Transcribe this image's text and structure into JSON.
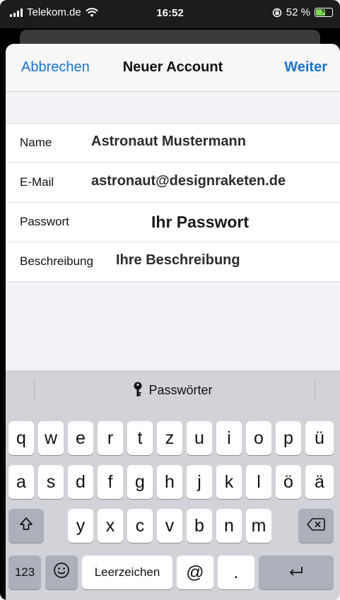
{
  "status_bar": {
    "carrier": "Telekom.de",
    "time": "16:52",
    "battery": "52 %"
  },
  "nav": {
    "cancel": "Abbrechen",
    "title": "Neuer Account",
    "next": "Weiter"
  },
  "form": {
    "rows": [
      {
        "label": "Name",
        "value": "Astronaut Mustermann"
      },
      {
        "label": "E-Mail",
        "value": "astronaut@designraketen.de"
      },
      {
        "label": "Passwort",
        "value": "Ihr Passwort"
      },
      {
        "label": "Beschreibung",
        "value": "Ihre Beschreibung"
      }
    ]
  },
  "keyboard": {
    "suggestion": "Passwörter",
    "row1": [
      "q",
      "w",
      "e",
      "r",
      "t",
      "z",
      "u",
      "i",
      "o",
      "p",
      "ü"
    ],
    "row2": [
      "a",
      "s",
      "d",
      "f",
      "g",
      "h",
      "j",
      "k",
      "l",
      "ö",
      "ä"
    ],
    "row3": [
      "y",
      "x",
      "c",
      "v",
      "b",
      "n",
      "m"
    ],
    "numbers_key": "123",
    "space_key": "Leerzeichen",
    "at_key": "@",
    "dot_key": "."
  },
  "icons": {
    "signal": "signal-bars-icon",
    "wifi": "wifi-icon",
    "lock": "orientation-lock-icon",
    "battery": "battery-charging-icon",
    "key": "key-icon",
    "shift": "shift-icon",
    "backspace": "backspace-icon",
    "emoji": "emoji-icon",
    "return": "return-icon"
  },
  "colors": {
    "accent": "#1a73d1",
    "battery_fill": "#7ed957"
  }
}
